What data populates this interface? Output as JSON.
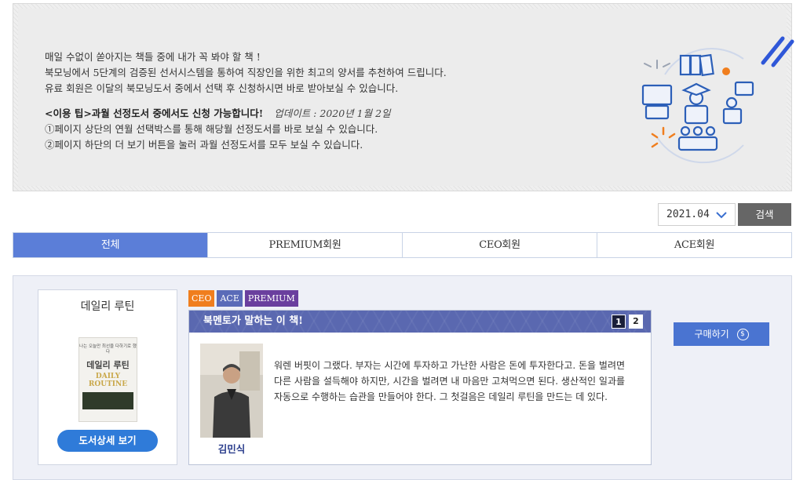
{
  "intro": {
    "line1": "매일 수없이 쏟아지는 책들 중에 내가 꼭 봐야 할 책 !",
    "line2": "북모닝에서 5단계의 검증된 선서시스템을 통하여 직장인을 위한 최고의 양서를 추천하여 드립니다.",
    "line3": "유료 회원은 이달의 북모닝도서 중에서 선택 후 신청하시면 바로 받아보실 수 있습니다.",
    "tip": "<이용 팁>과월 선정도서 중에서도 신청 가능합니다!",
    "update": "업데이트 : 2020년 1월 2일",
    "tip1": "①페이지 상단의 연월 선택박스를 통해 해당월 선정도서를 바로 보실 수 있습니다.",
    "tip2": "②페이지 하단의 더 보기 버튼을 눌러 과월 선정도서를 모두 보실 수 있습니다."
  },
  "search": {
    "month": "2021.04",
    "button": "검색"
  },
  "tabs": [
    {
      "label": "전체",
      "active": true
    },
    {
      "label": "PREMIUM회원",
      "active": false
    },
    {
      "label": "CEO회원",
      "active": false
    },
    {
      "label": "ACE회원",
      "active": false
    }
  ],
  "book": {
    "title": "데일리 루틴",
    "cover": {
      "tagline": "나는 오늘만 최선을 다하기로 했다",
      "korean_title": "데일리 루틴",
      "english_title": "DAILY ROUTINE"
    },
    "detail_button": "도서상세 보기",
    "badges": [
      {
        "label": "CEO",
        "color": "#f07e1e"
      },
      {
        "label": "ACE",
        "color": "#5a6bb8"
      },
      {
        "label": "PREMIUM",
        "color": "#6a3f9e"
      }
    ],
    "mentor_heading": "북멘토가 말하는 이 책!",
    "pages": [
      "1",
      "2"
    ],
    "mentor_name": "김민식",
    "quote": "워렌 버핏이 그랬다. 부자는 시간에 투자하고 가난한 사람은 돈에 투자한다고. 돈을 벌려면 다른 사람을 설득해야 하지만, 시간을 벌려면 내 마음만 고쳐먹으면 된다. 생산적인 일과를 자동으로 수행하는 습관을 만들어야 한다. 그 첫걸음은 데일리 루틴을 만드는 데 있다.",
    "buy_button": "구매하기",
    "buy_icon": "coin-icon"
  },
  "colors": {
    "tab_active": "#5b7ed8",
    "buy": "#4a74d1",
    "detail": "#2f7bd9",
    "mentor_head": "#5a68b0"
  }
}
